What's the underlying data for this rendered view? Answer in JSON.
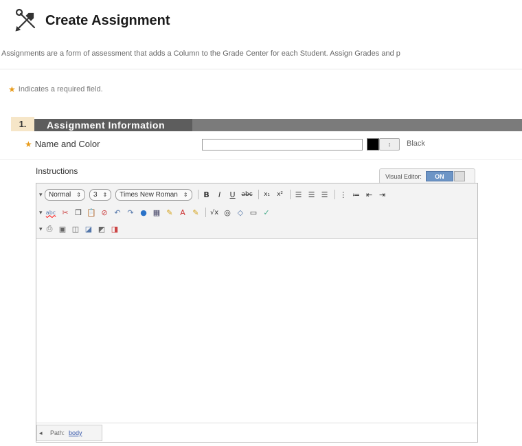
{
  "header": {
    "title": "Create Assignment",
    "description": "Assignments are a form of assessment that adds a Column to the Grade Center for each Student. Assign Grades and p"
  },
  "required_note": "Indicates a required field.",
  "section": {
    "number": "1.",
    "title": "Assignment Information"
  },
  "name_field": {
    "label": "Name and Color",
    "value": "",
    "color_name": "Black",
    "color_button_label": "↕",
    "swatch_color": "#000000"
  },
  "instructions": {
    "label": "Instructions",
    "visual_editor_label": "Visual Editor:",
    "visual_editor_state": "ON"
  },
  "toolbar": {
    "format_select": "Normal",
    "size_select": "3",
    "font_select": "Times New Roman",
    "bold": "B",
    "italic": "I",
    "underline": "U",
    "strike": "abc",
    "subscript": "x₁",
    "superscript": "x²",
    "spellcheck": "abc"
  },
  "statusbar": {
    "path_label": "Path:",
    "path_value": "body"
  },
  "colors": {
    "section_bar": "#7b7b7b",
    "section_num_bg": "#f6e6c8",
    "star": "#e89b1a",
    "toggle_on": "#6d95c6"
  }
}
